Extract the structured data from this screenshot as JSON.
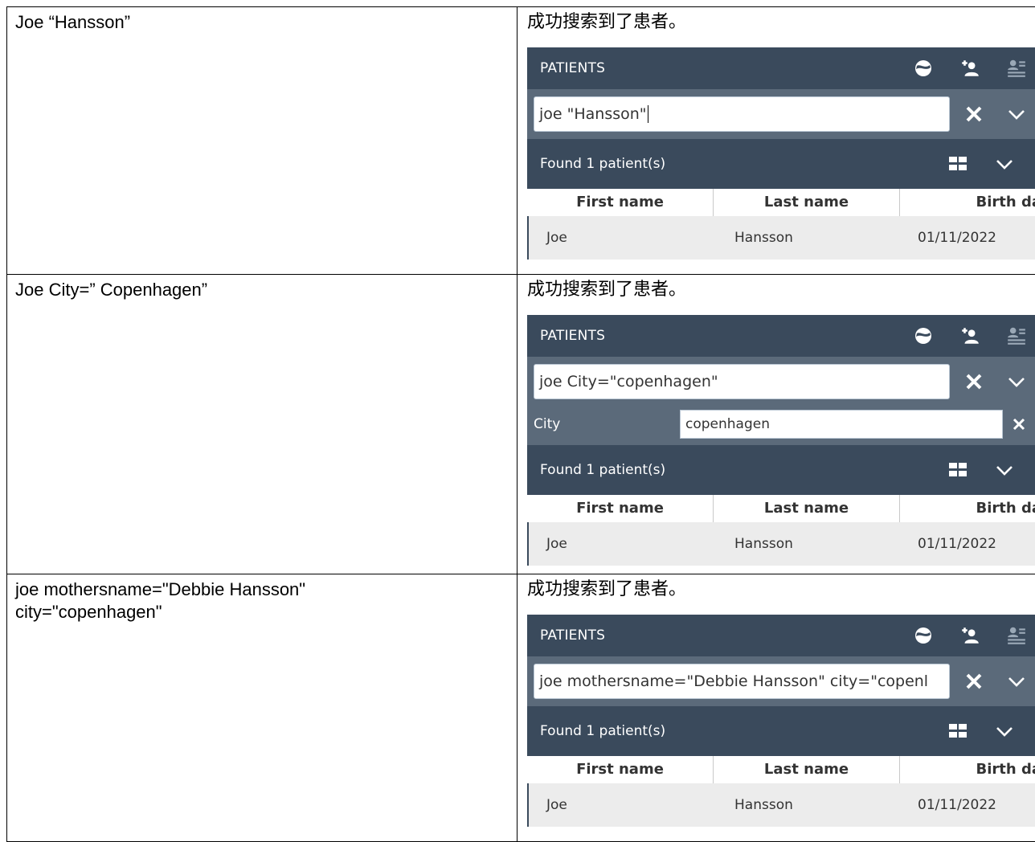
{
  "cases": [
    {
      "input_text": "Joe “Hansson”",
      "result_text": "成功搜索到了患者。",
      "widget": {
        "title": "PATIENTS",
        "search_value": "joe \"Hansson\"",
        "found_label": "Found 1 patient(s)",
        "columns": [
          "First name",
          "Last name",
          "Birth da"
        ],
        "row": [
          "Joe",
          "Hansson",
          "01/11/2022"
        ]
      }
    },
    {
      "input_text": "Joe City=” Copenhagen”",
      "result_text": "成功搜索到了患者。",
      "widget": {
        "title": "PATIENTS",
        "search_value": "joe City=\"copenhagen\"",
        "filter_label": "City",
        "filter_value": "copenhagen",
        "found_label": "Found 1 patient(s)",
        "columns": [
          "First name",
          "Last name",
          "Birth da"
        ],
        "row": [
          "Joe",
          "Hansson",
          "01/11/2022"
        ]
      }
    },
    {
      "input_text": "joe mothersname=\"Debbie Hansson\"\ncity=\"copenhagen\"",
      "result_text": "成功搜索到了患者。",
      "widget": {
        "title": "PATIENTS",
        "search_value": "joe mothersname=\"Debbie Hansson\" city=\"copenl",
        "found_label": "Found 1 patient(s)",
        "columns": [
          "First name",
          "Last name",
          "Birth da"
        ],
        "row": [
          "Joe",
          "Hansson",
          "01/11/2022"
        ]
      }
    }
  ],
  "icons": [
    "globe-icon",
    "add-patient-icon",
    "patient-list-icon",
    "close-icon",
    "chevron-down-icon",
    "grid-view-icon"
  ],
  "colors": {
    "header_bg": "#3a4a5c",
    "search_bg": "#5b6a7a",
    "row_bg": "#ececec"
  }
}
